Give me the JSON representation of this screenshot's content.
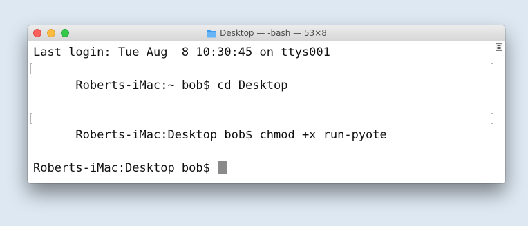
{
  "window": {
    "title": "Desktop — -bash — 53×8"
  },
  "terminal": {
    "lines": [
      "Last login: Tue Aug  8 10:30:45 on ttys001",
      "Roberts-iMac:~ bob$ cd Desktop",
      "Roberts-iMac:Desktop bob$ chmod +x run-pyote",
      "Roberts-iMac:Desktop bob$ "
    ]
  },
  "icons": {
    "folder": "folder-icon",
    "scroll": "scroll-bar-icon"
  },
  "colors": {
    "close": "#fc605c",
    "minimize": "#fdbc40",
    "zoom": "#34c84a",
    "folder": "#3d9cf0"
  }
}
